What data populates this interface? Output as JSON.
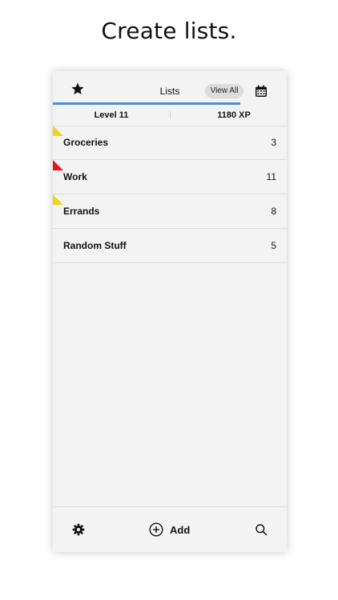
{
  "caption": "Create lists.",
  "header": {
    "title": "Lists",
    "view_all_label": "View All",
    "star_icon": "star-icon",
    "calendar_icon": "calendar-icon"
  },
  "level": {
    "level_label": "Level 11",
    "xp_label": "1180 XP",
    "progress": 0.8
  },
  "lists": [
    {
      "name": "Groceries",
      "count": "3",
      "flag_color": "#f2d21b"
    },
    {
      "name": "Work",
      "count": "11",
      "flag_color": "#e3161d"
    },
    {
      "name": "Errands",
      "count": "8",
      "flag_color": "#f2d21b"
    },
    {
      "name": "Random Stuff",
      "count": "5",
      "flag_color": null
    }
  ],
  "footer": {
    "add_label": "Add",
    "settings_icon": "gear-icon",
    "add_icon": "plus-circle-icon",
    "search_icon": "search-icon"
  },
  "colors": {
    "accent": "#4a90d9",
    "flag_yellow": "#f2d21b",
    "flag_red": "#e3161d"
  }
}
